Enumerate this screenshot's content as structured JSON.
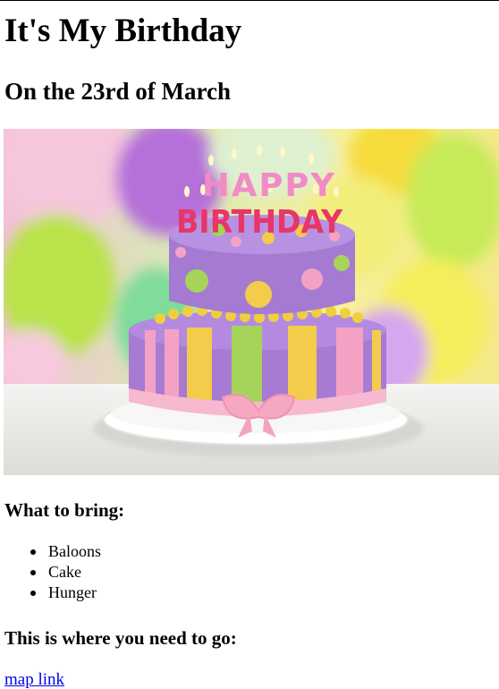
{
  "header": {
    "title": "It's My Birthday",
    "date": "On the 23rd of March"
  },
  "image": {
    "topper_line1": "HAPPY",
    "topper_line2": "BIRTHDAY"
  },
  "bring": {
    "heading": "What to bring:",
    "items": [
      "Baloons",
      "Cake",
      "Hunger"
    ]
  },
  "directions": {
    "heading": "This is where you need to go:",
    "link_text": "map link"
  }
}
